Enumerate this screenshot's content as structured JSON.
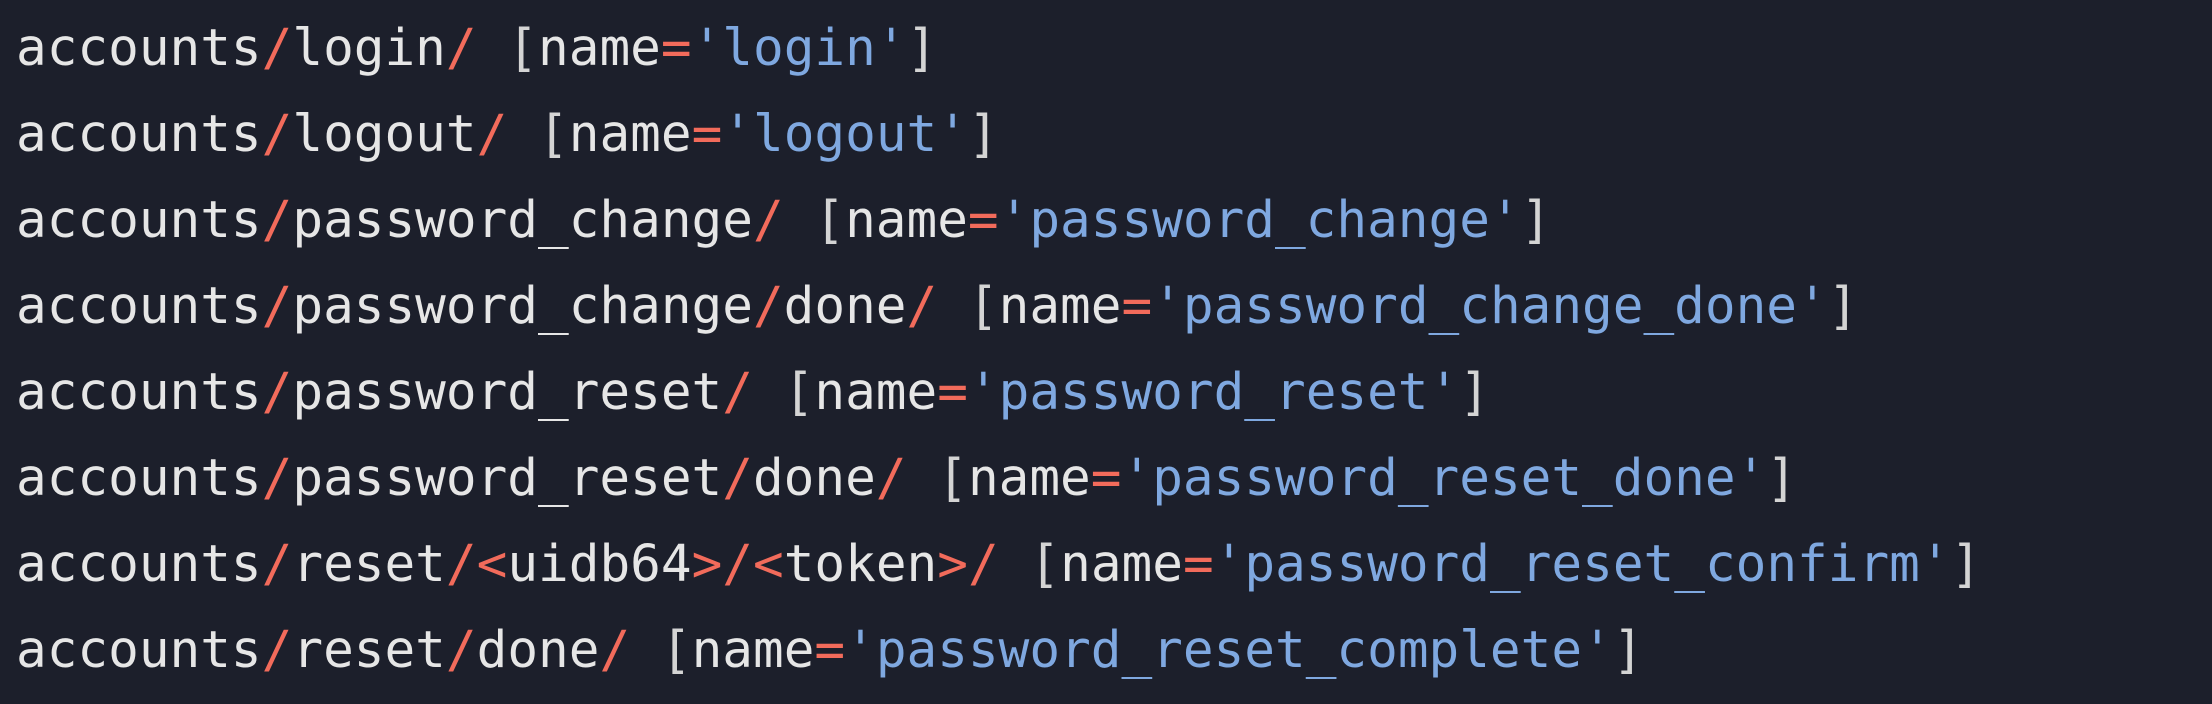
{
  "colors": {
    "background": "#1c1f2b",
    "text": "#e6e6e6",
    "punctuation_accent": "#f26b5b",
    "string": "#7fa8e0"
  },
  "lines": [
    {
      "tokens": [
        {
          "t": "accounts",
          "k": "path"
        },
        {
          "t": "/",
          "k": "slash"
        },
        {
          "t": "login",
          "k": "path"
        },
        {
          "t": "/",
          "k": "slash"
        },
        {
          "t": " ",
          "k": "path"
        },
        {
          "t": "[",
          "k": "bracket"
        },
        {
          "t": "name",
          "k": "key"
        },
        {
          "t": "=",
          "k": "op"
        },
        {
          "t": "'login'",
          "k": "string"
        },
        {
          "t": "]",
          "k": "bracket"
        }
      ]
    },
    {
      "tokens": [
        {
          "t": "accounts",
          "k": "path"
        },
        {
          "t": "/",
          "k": "slash"
        },
        {
          "t": "logout",
          "k": "path"
        },
        {
          "t": "/",
          "k": "slash"
        },
        {
          "t": " ",
          "k": "path"
        },
        {
          "t": "[",
          "k": "bracket"
        },
        {
          "t": "name",
          "k": "key"
        },
        {
          "t": "=",
          "k": "op"
        },
        {
          "t": "'logout'",
          "k": "string"
        },
        {
          "t": "]",
          "k": "bracket"
        }
      ]
    },
    {
      "tokens": [
        {
          "t": "accounts",
          "k": "path"
        },
        {
          "t": "/",
          "k": "slash"
        },
        {
          "t": "password_change",
          "k": "path"
        },
        {
          "t": "/",
          "k": "slash"
        },
        {
          "t": " ",
          "k": "path"
        },
        {
          "t": "[",
          "k": "bracket"
        },
        {
          "t": "name",
          "k": "key"
        },
        {
          "t": "=",
          "k": "op"
        },
        {
          "t": "'password_change'",
          "k": "string"
        },
        {
          "t": "]",
          "k": "bracket"
        }
      ]
    },
    {
      "tokens": [
        {
          "t": "accounts",
          "k": "path"
        },
        {
          "t": "/",
          "k": "slash"
        },
        {
          "t": "password_change",
          "k": "path"
        },
        {
          "t": "/",
          "k": "slash"
        },
        {
          "t": "done",
          "k": "path"
        },
        {
          "t": "/",
          "k": "slash"
        },
        {
          "t": " ",
          "k": "path"
        },
        {
          "t": "[",
          "k": "bracket"
        },
        {
          "t": "name",
          "k": "key"
        },
        {
          "t": "=",
          "k": "op"
        },
        {
          "t": "'password_change_done'",
          "k": "string"
        },
        {
          "t": "]",
          "k": "bracket"
        }
      ]
    },
    {
      "tokens": [
        {
          "t": "accounts",
          "k": "path"
        },
        {
          "t": "/",
          "k": "slash"
        },
        {
          "t": "password_reset",
          "k": "path"
        },
        {
          "t": "/",
          "k": "slash"
        },
        {
          "t": " ",
          "k": "path"
        },
        {
          "t": "[",
          "k": "bracket"
        },
        {
          "t": "name",
          "k": "key"
        },
        {
          "t": "=",
          "k": "op"
        },
        {
          "t": "'password_reset'",
          "k": "string"
        },
        {
          "t": "]",
          "k": "bracket"
        }
      ]
    },
    {
      "tokens": [
        {
          "t": "accounts",
          "k": "path"
        },
        {
          "t": "/",
          "k": "slash"
        },
        {
          "t": "password_reset",
          "k": "path"
        },
        {
          "t": "/",
          "k": "slash"
        },
        {
          "t": "done",
          "k": "path"
        },
        {
          "t": "/",
          "k": "slash"
        },
        {
          "t": " ",
          "k": "path"
        },
        {
          "t": "[",
          "k": "bracket"
        },
        {
          "t": "name",
          "k": "key"
        },
        {
          "t": "=",
          "k": "op"
        },
        {
          "t": "'password_reset_done'",
          "k": "string"
        },
        {
          "t": "]",
          "k": "bracket"
        }
      ]
    },
    {
      "tokens": [
        {
          "t": "accounts",
          "k": "path"
        },
        {
          "t": "/",
          "k": "slash"
        },
        {
          "t": "reset",
          "k": "path"
        },
        {
          "t": "/",
          "k": "slash"
        },
        {
          "t": "<",
          "k": "op"
        },
        {
          "t": "uidb64",
          "k": "path"
        },
        {
          "t": ">",
          "k": "op"
        },
        {
          "t": "/",
          "k": "slash"
        },
        {
          "t": "<",
          "k": "op"
        },
        {
          "t": "token",
          "k": "path"
        },
        {
          "t": ">",
          "k": "op"
        },
        {
          "t": "/",
          "k": "slash"
        },
        {
          "t": " ",
          "k": "path"
        },
        {
          "t": "[",
          "k": "bracket"
        },
        {
          "t": "name",
          "k": "key"
        },
        {
          "t": "=",
          "k": "op"
        },
        {
          "t": "'password_reset_confirm'",
          "k": "string"
        },
        {
          "t": "]",
          "k": "bracket"
        }
      ]
    },
    {
      "tokens": [
        {
          "t": "accounts",
          "k": "path"
        },
        {
          "t": "/",
          "k": "slash"
        },
        {
          "t": "reset",
          "k": "path"
        },
        {
          "t": "/",
          "k": "slash"
        },
        {
          "t": "done",
          "k": "path"
        },
        {
          "t": "/",
          "k": "slash"
        },
        {
          "t": " ",
          "k": "path"
        },
        {
          "t": "[",
          "k": "bracket"
        },
        {
          "t": "name",
          "k": "key"
        },
        {
          "t": "=",
          "k": "op"
        },
        {
          "t": "'password_reset_complete'",
          "k": "string"
        },
        {
          "t": "]",
          "k": "bracket"
        }
      ]
    }
  ]
}
